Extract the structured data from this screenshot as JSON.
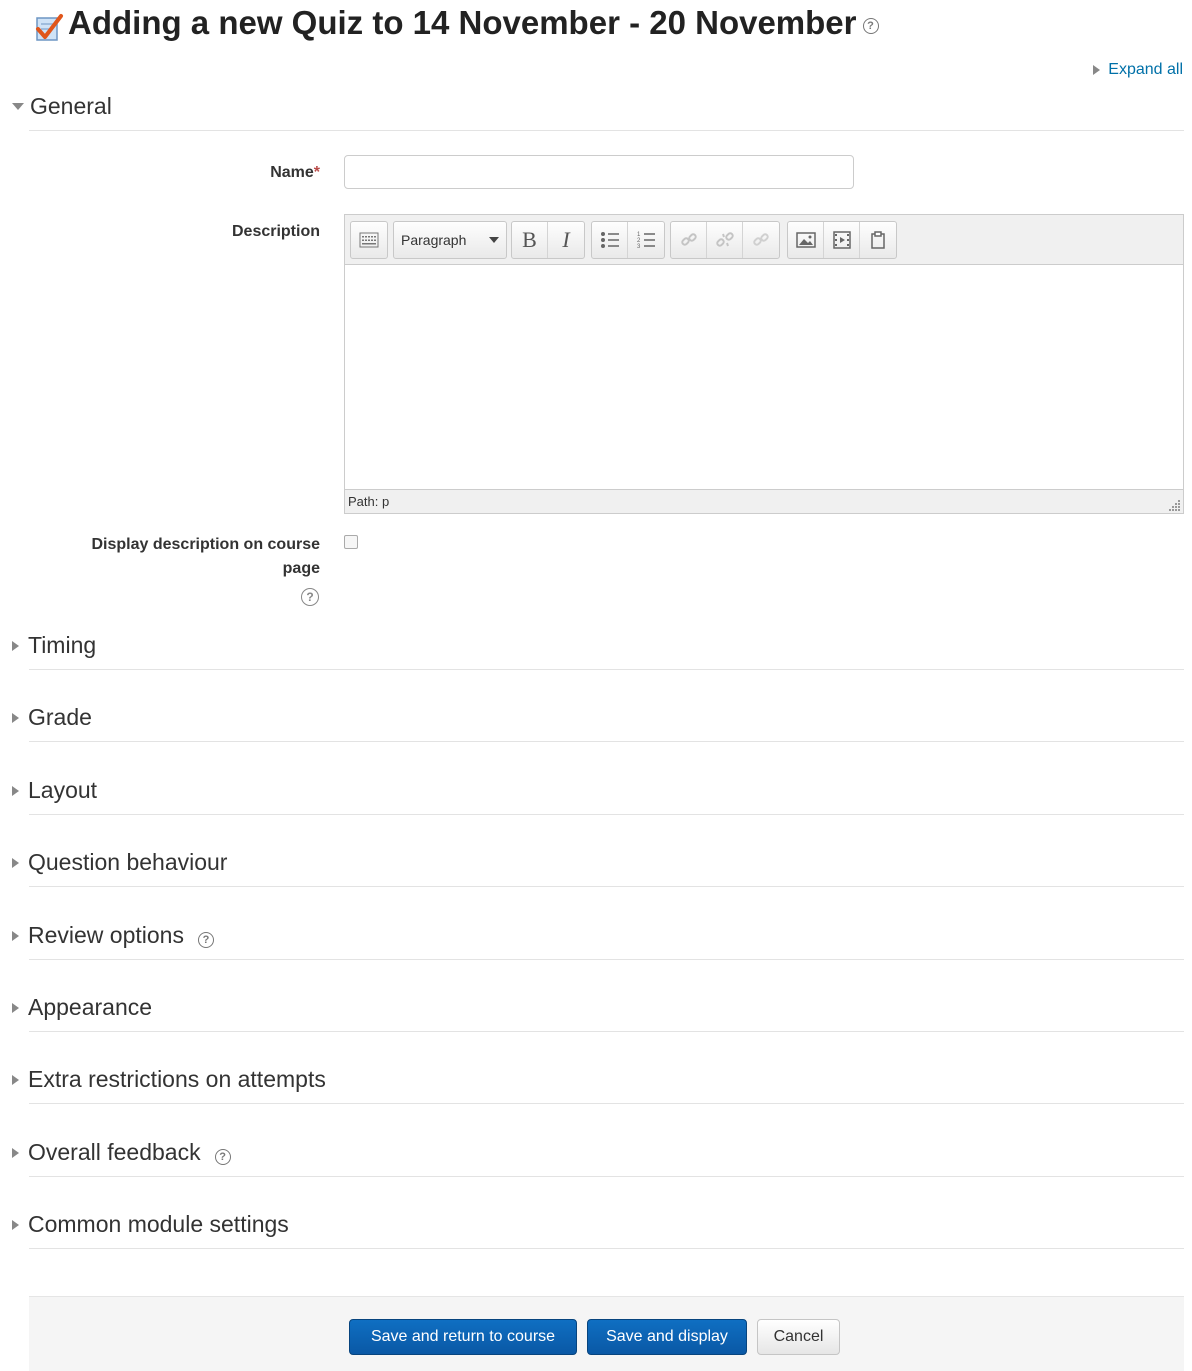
{
  "page": {
    "title": "Adding a new Quiz to 14 November - 20 November",
    "help_glyph": "?",
    "expand_all": "Expand all"
  },
  "general": {
    "heading": "General",
    "name_label": "Name",
    "required_mark": "*",
    "name_value": "",
    "description_label": "Description",
    "format_select": "Paragraph",
    "bold_glyph": "B",
    "italic_glyph": "I",
    "status_path": "Path: p",
    "display_desc_label": "Display description on course page",
    "display_desc_checked": false
  },
  "sections": [
    {
      "label": "Timing",
      "help": false
    },
    {
      "label": "Grade",
      "help": false
    },
    {
      "label": "Layout",
      "help": false
    },
    {
      "label": "Question behaviour",
      "help": false
    },
    {
      "label": "Review options",
      "help": true
    },
    {
      "label": "Appearance",
      "help": false
    },
    {
      "label": "Extra restrictions on attempts",
      "help": false
    },
    {
      "label": "Overall feedback",
      "help": true
    },
    {
      "label": "Common module settings",
      "help": false
    }
  ],
  "buttons": {
    "save_return": "Save and return to course",
    "save_display": "Save and display",
    "cancel": "Cancel"
  },
  "colors": {
    "link": "#0070a8",
    "primary": "#0a5fad",
    "required": "#b94a48"
  }
}
